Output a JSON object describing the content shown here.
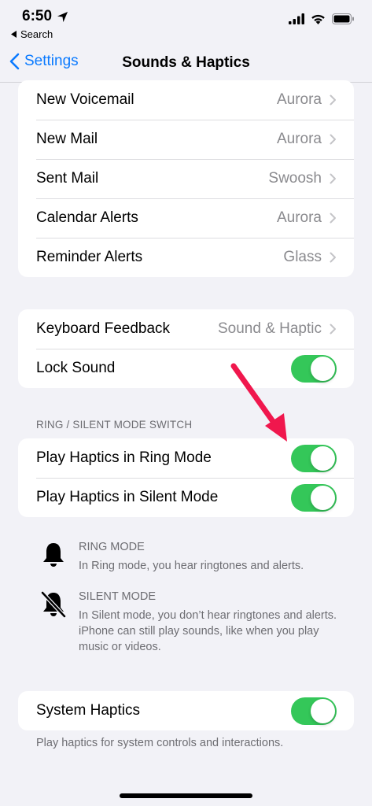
{
  "status": {
    "time": "6:50",
    "back_app": "Search"
  },
  "nav": {
    "back_label": "Settings",
    "title": "Sounds & Haptics"
  },
  "sounds": [
    {
      "label": "New Voicemail",
      "value": "Aurora"
    },
    {
      "label": "New Mail",
      "value": "Aurora"
    },
    {
      "label": "Sent Mail",
      "value": "Swoosh"
    },
    {
      "label": "Calendar Alerts",
      "value": "Aurora"
    },
    {
      "label": "Reminder Alerts",
      "value": "Glass"
    }
  ],
  "feedback": {
    "keyboard_label": "Keyboard Feedback",
    "keyboard_value": "Sound & Haptic",
    "lock_label": "Lock Sound",
    "lock_on": true
  },
  "ring_section": {
    "header": "RING / SILENT MODE SWITCH",
    "ring_haptics_label": "Play Haptics in Ring Mode",
    "ring_haptics_on": true,
    "silent_haptics_label": "Play Haptics in Silent Mode",
    "silent_haptics_on": true
  },
  "info": {
    "ring_title": "RING MODE",
    "ring_text": "In Ring mode, you hear ringtones and alerts.",
    "silent_title": "SILENT MODE",
    "silent_text": "In Silent mode, you don’t hear ringtones and alerts. iPhone can still play sounds, like when you play music or videos."
  },
  "system": {
    "label": "System Haptics",
    "on": true,
    "footnote": "Play haptics for system controls and interactions."
  },
  "colors": {
    "accent": "#0a7aff",
    "toggle_on": "#34c759",
    "annotation_arrow": "#f0174d"
  },
  "icons": [
    "location-arrow-icon",
    "signal-icon",
    "wifi-icon",
    "battery-icon",
    "chevron-left-icon",
    "chevron-right-icon",
    "bell-icon",
    "bell-slash-icon"
  ]
}
